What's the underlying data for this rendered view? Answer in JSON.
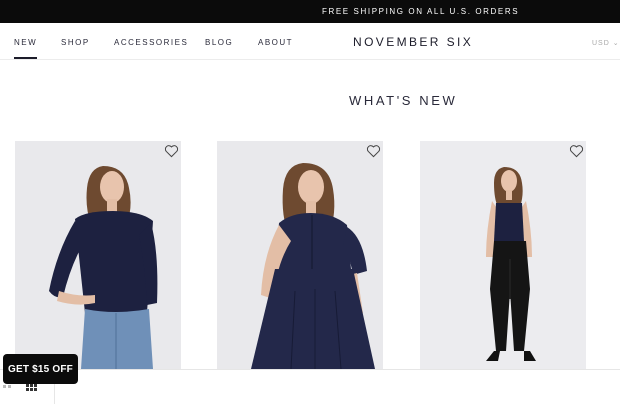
{
  "announcement": "FREE SHIPPING ON ALL U.S. ORDERS",
  "nav": {
    "items": [
      {
        "label": "NEW",
        "active": true
      },
      {
        "label": "SHOP",
        "active": false
      },
      {
        "label": "ACCESSORIES",
        "active": false
      },
      {
        "label": "BLOG",
        "active": false
      },
      {
        "label": "ABOUT",
        "active": false
      }
    ],
    "brand": "NOVEMBER SIX",
    "currency": "USD"
  },
  "section_title": "WHAT'S NEW",
  "products": [
    {
      "image": "navy long-sleeve top with jeans",
      "wishlist_icon": "heart-outline-icon"
    },
    {
      "image": "navy pleated dress",
      "wishlist_icon": "heart-outline-icon"
    },
    {
      "image": "navy top with black leather pants",
      "wishlist_icon": "heart-outline-icon"
    }
  ],
  "promo": {
    "label": "GET $15 OFF"
  },
  "colors": {
    "announcement_bg": "#0b0b0b",
    "text": "#1c1c2a",
    "card_bg": "#e9e9ec",
    "garment": "#1d2140"
  }
}
